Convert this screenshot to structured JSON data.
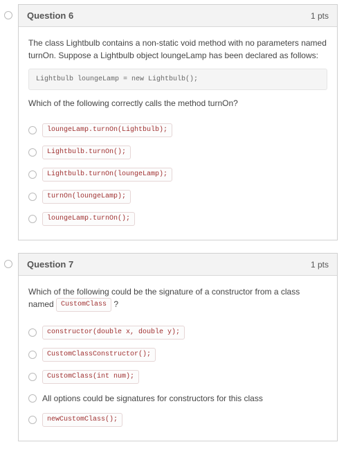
{
  "questions": [
    {
      "number": "Question 6",
      "points": "1 pts",
      "prompt_parts": [
        {
          "type": "text",
          "value": "The class Lightbulb contains a non-static void method with no parameters named turnOn. Suppose a Lightbulb object loungeLamp has been declared as follows:"
        },
        {
          "type": "codeblock",
          "value": "Lightbulb loungeLamp = new Lightbulb();"
        },
        {
          "type": "text",
          "value": "Which of the following correctly calls the method turnOn?"
        }
      ],
      "options": [
        {
          "kind": "code",
          "value": "loungeLamp.turnOn(Lightbulb);"
        },
        {
          "kind": "code",
          "value": "Lightbulb.turnOn();"
        },
        {
          "kind": "code",
          "value": "Lightbulb.turnOn(loungeLamp);"
        },
        {
          "kind": "code",
          "value": "turnOn(loungeLamp);"
        },
        {
          "kind": "code",
          "value": "loungeLamp.turnOn();"
        }
      ]
    },
    {
      "number": "Question 7",
      "points": "1 pts",
      "prompt_parts": [
        {
          "type": "text_with_code",
          "before": "Which of the following could be the signature of a constructor from a class named ",
          "code": "CustomClass",
          "after": " ?"
        }
      ],
      "options": [
        {
          "kind": "code",
          "value": "constructor(double x, double y);"
        },
        {
          "kind": "code",
          "value": "CustomClassConstructor();"
        },
        {
          "kind": "code",
          "value": "CustomClass(int num);"
        },
        {
          "kind": "plain",
          "value": "All options could be signatures for constructors for this class"
        },
        {
          "kind": "code",
          "value": "newCustomClass();"
        }
      ]
    }
  ]
}
